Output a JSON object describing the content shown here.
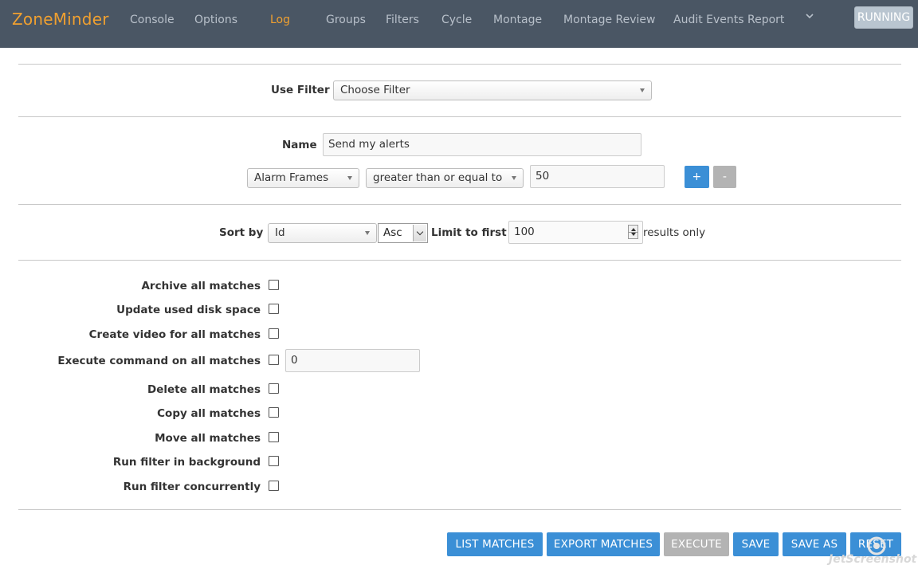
{
  "navbar": {
    "brand": "ZoneMinder",
    "items": [
      "Console",
      "Options",
      "Log",
      "Groups",
      "Filters",
      "Cycle",
      "Montage",
      "Montage Review",
      "Audit Events Report"
    ],
    "active_item": "Log",
    "status_badge": "RUNNING",
    "colors": {
      "background": "#4a5664",
      "brand": "#f0a030",
      "item": "#b8c0ca"
    }
  },
  "filter_select": {
    "label": "Use Filter",
    "value": "Choose Filter"
  },
  "name_field": {
    "label": "Name",
    "value": "Send my alerts"
  },
  "term": {
    "attribute": "Alarm Frames",
    "operator": "greater than or equal to",
    "value": "50",
    "add_label": "+",
    "remove_label": "-"
  },
  "sort": {
    "label": "Sort by",
    "field": "Id",
    "direction": "Asc",
    "limit_label": "Limit to first",
    "limit_value": "100",
    "limit_suffix": "results only"
  },
  "actions": [
    {
      "label": "Archive all matches",
      "checked": false
    },
    {
      "label": "Update used disk space",
      "checked": false
    },
    {
      "label": "Create video for all matches",
      "checked": false
    },
    {
      "label": "Execute command on all matches",
      "checked": false,
      "command": "0"
    },
    {
      "label": "Delete all matches",
      "checked": false
    },
    {
      "label": "Copy all matches",
      "checked": false
    },
    {
      "label": "Move all matches",
      "checked": false
    },
    {
      "label": "Run filter in background",
      "checked": false
    },
    {
      "label": "Run filter concurrently",
      "checked": false
    }
  ],
  "buttons": {
    "list_matches": "LIST MATCHES",
    "export_matches": "EXPORT MATCHES",
    "execute": "EXECUTE",
    "save": "SAVE",
    "save_as": "SAVE AS",
    "reset": "RESET"
  },
  "watermark": "JetScreenshot",
  "colors": {
    "primary_button": "#3b8fd6",
    "disabled_button": "#b3b3b3"
  }
}
